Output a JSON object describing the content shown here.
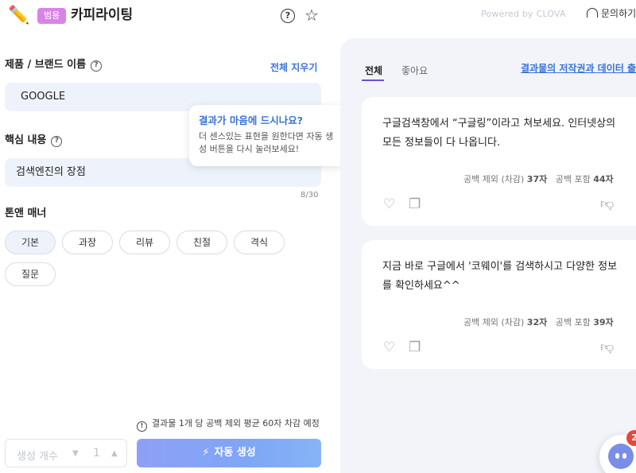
{
  "header": {
    "badge": "범용",
    "title": "카피라이팅",
    "help_glyph": "?",
    "powered_by": "Powered by CLOVA",
    "inquiry": "문의하기"
  },
  "form": {
    "brand_label": "제품 / 브랜드 이름",
    "clear_all": "전체 지우기",
    "brand_value": "GOOGLE",
    "core_label": "핵심 내용",
    "core_value": "검색엔진의 장점",
    "char_count": "8/30",
    "tone_label": "톤앤 매너",
    "tones": [
      "기본",
      "과장",
      "리뷰",
      "친절",
      "격식",
      "질문"
    ],
    "selected_tone": "기본"
  },
  "tooltip": {
    "title": "결과가 마음에 드시나요?",
    "body": "더 센스있는 표현을 원한다면 자동 생성 버튼을 다시 눌러보세요!"
  },
  "bottom": {
    "notice": "결과물 1개 당 공백 제외 평균 60자 차감 예정",
    "gen_count_label": "생성 개수",
    "gen_count_value": "1",
    "generate_label": "자동 생성"
  },
  "results": {
    "tabs": [
      "전체",
      "좋아요"
    ],
    "active_tab": "전체",
    "copyright_link": "결과물의 저작권과 데이터 출처",
    "cards": [
      {
        "text": "구글검색창에서 “구글링”이라고 쳐보세요. 인터넷상의 모든 정보들이 다 나옵니다.",
        "excl_label": "공백 제외 (차감)",
        "excl_value": "37자",
        "incl_label": "공백 포함",
        "incl_value": "44자"
      },
      {
        "text": "지금 바로 구글에서 '코웨이'를 검색하시고 다양한 정보를 확인하세요^^",
        "excl_label": "공백 제외 (차감)",
        "excl_value": "32자",
        "incl_label": "공백 포함",
        "incl_value": "39자"
      }
    ]
  },
  "chat": {
    "notification_count": "2"
  },
  "colors": {
    "accent_blue": "#3a73d9",
    "badge_purple": "#d884e6",
    "tab_underline": "#6b4dd6",
    "notification_red": "#e2483d"
  },
  "icons": {
    "app": "pencil-icon",
    "help": "question-circle-icon",
    "favorite": "star-icon",
    "inquiry": "headphones-icon",
    "notice": "exclamation-circle-icon",
    "generate": "magic-wand-icon",
    "like": "heart-icon",
    "copy": "copy-icon",
    "dislike": "thumbs-down-icon"
  }
}
